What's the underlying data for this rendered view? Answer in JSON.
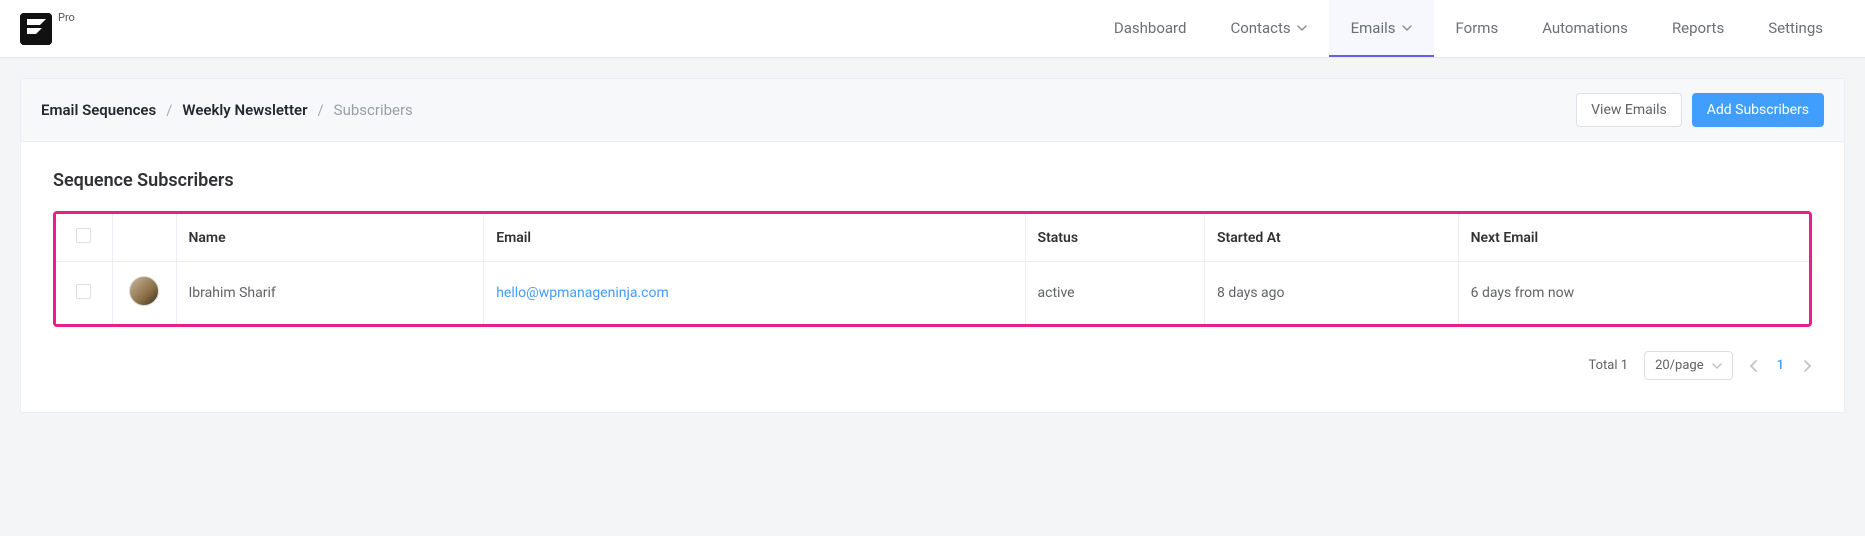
{
  "brand": {
    "pro_label": "Pro"
  },
  "nav": {
    "dashboard": "Dashboard",
    "contacts": "Contacts",
    "emails": "Emails",
    "forms": "Forms",
    "automations": "Automations",
    "reports": "Reports",
    "settings": "Settings"
  },
  "breadcrumb": {
    "root": "Email Sequences",
    "seq": "Weekly Newsletter",
    "current": "Subscribers"
  },
  "actions": {
    "view_emails": "View Emails",
    "add_subscribers": "Add Subscribers"
  },
  "section": {
    "title": "Sequence Subscribers"
  },
  "table": {
    "headers": {
      "name": "Name",
      "email": "Email",
      "status": "Status",
      "started_at": "Started At",
      "next_email": "Next Email"
    },
    "rows": [
      {
        "name": "Ibrahim Sharif",
        "email": "hello@wpmanageninja.com",
        "status": "active",
        "started_at": "8 days ago",
        "next_email": "6 days from now"
      }
    ]
  },
  "pagination": {
    "total_label": "Total 1",
    "page_size": "20/page",
    "current": "1"
  }
}
